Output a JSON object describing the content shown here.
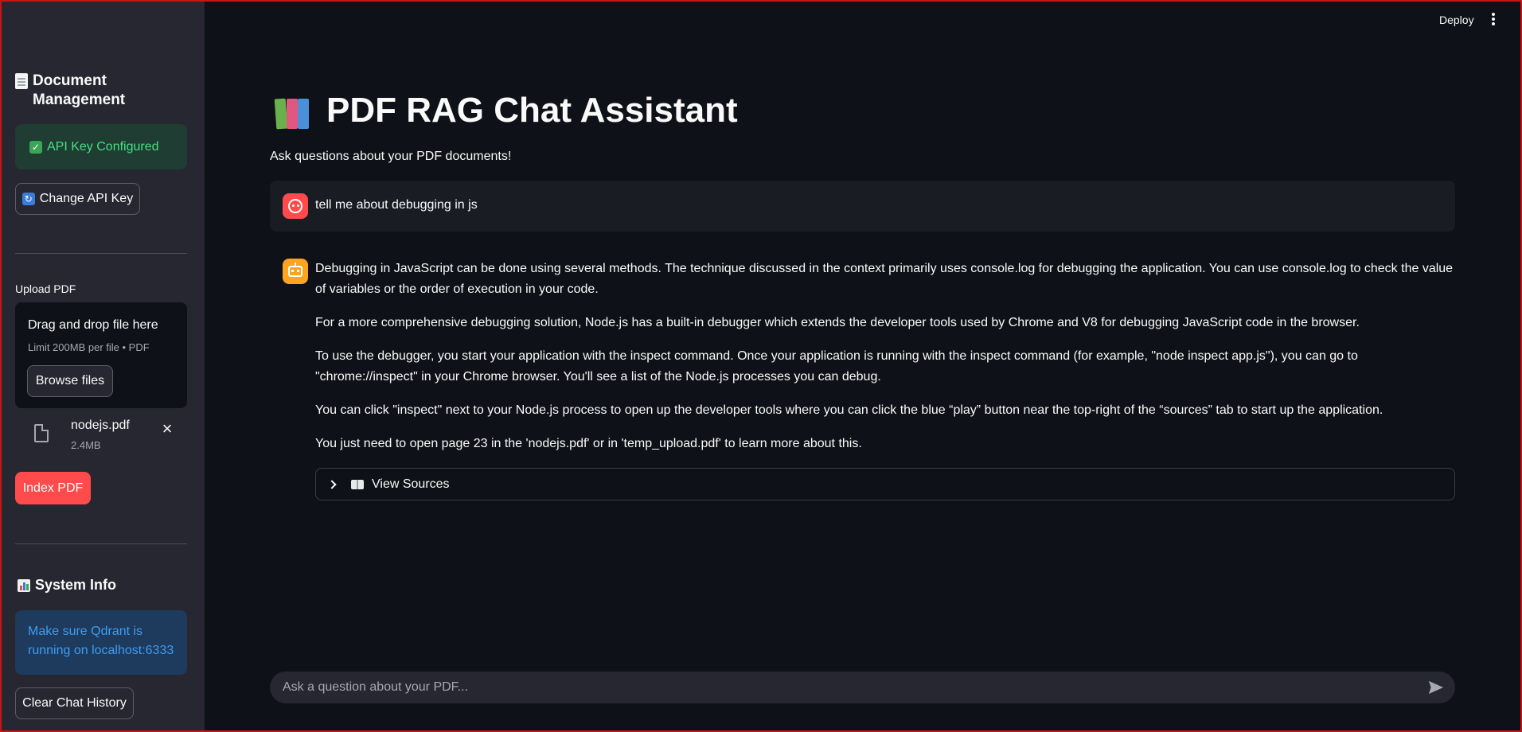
{
  "header": {
    "deploy_label": "Deploy",
    "menu_icon": "kebab-menu-icon"
  },
  "sidebar": {
    "title": "Document Management",
    "title_icon": "document-icon",
    "api_status": "API Key Configured",
    "change_api_key": "Change API Key",
    "upload_label": "Upload PDF",
    "dropzone_title": "Drag and drop file here",
    "dropzone_limit": "Limit 200MB per file • PDF",
    "browse_label": "Browse files",
    "file": {
      "name": "nodejs.pdf",
      "size": "2.4MB"
    },
    "index_label": "Index PDF",
    "system_info_title": "System Info",
    "system_info_text": "Make sure Qdrant is running on localhost:6333",
    "clear_label": "Clear Chat History"
  },
  "main": {
    "title": "PDF RAG Chat Assistant",
    "subtitle": "Ask questions about your PDF documents!",
    "messages": [
      {
        "role": "user",
        "text": "tell me about debugging in js"
      },
      {
        "role": "assistant",
        "paragraphs": [
          "Debugging in JavaScript can be done using several methods. The technique discussed in the context primarily uses console.log for debugging the application. You can use console.log to check the value of variables or the order of execution in your code.",
          "For a more comprehensive debugging solution, Node.js has a built-in debugger which extends the developer tools used by Chrome and V8 for debugging JavaScript code in the browser.",
          "To use the debugger, you start your application with the inspect command. Once your application is running with the inspect command (for example, \"node inspect app.js\"), you can go to \"chrome://inspect\" in your Chrome browser. You'll see a list of the Node.js processes you can debug.",
          "You can click \"inspect\" next to your Node.js process to open up the developer tools where you can click the blue “play” button near the top-right of the “sources” tab to start up the application.",
          "You just need to open page 23 in the 'nodejs.pdf' or in 'temp_upload.pdf' to learn more about this."
        ]
      }
    ],
    "sources_label": "View Sources",
    "chat_placeholder": "Ask a question about your PDF..."
  },
  "colors": {
    "background": "#0e1117",
    "sidebar": "#262730",
    "primary": "#ff4b4b",
    "success_text": "#46e082",
    "info_text": "#3d9df3",
    "assistant_avatar": "#ffa421"
  }
}
